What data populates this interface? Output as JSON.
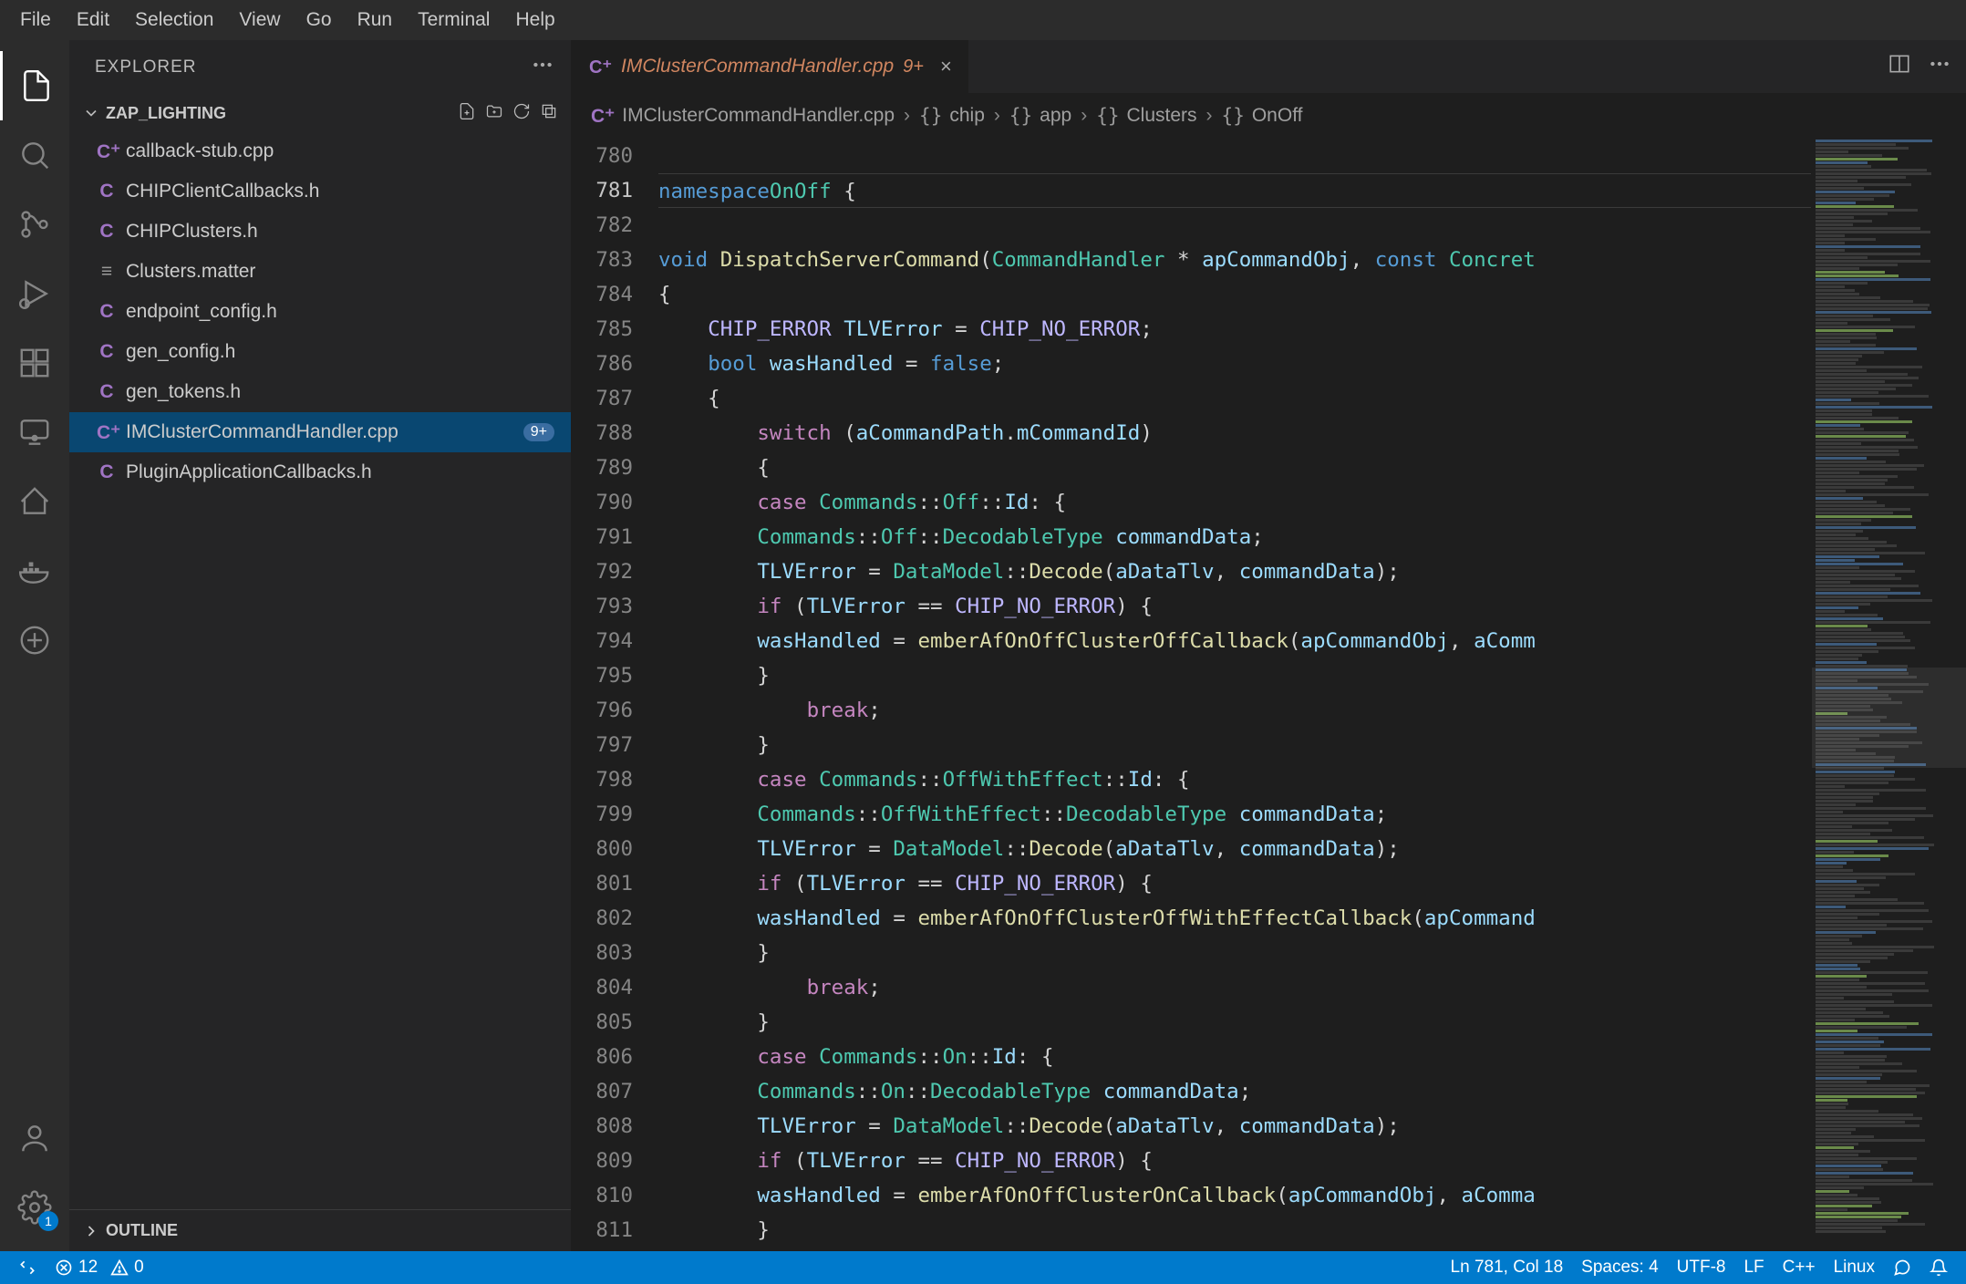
{
  "menubar": [
    "File",
    "Edit",
    "Selection",
    "View",
    "Go",
    "Run",
    "Terminal",
    "Help"
  ],
  "sidebar": {
    "title": "EXPLORER",
    "section": "ZAP_LIGHTING",
    "outline": "OUTLINE",
    "files": [
      {
        "name": "callback-stub.cpp",
        "icon": "C⁺",
        "iconClass": "cpp"
      },
      {
        "name": "CHIPClientCallbacks.h",
        "icon": "C",
        "iconClass": "c"
      },
      {
        "name": "CHIPClusters.h",
        "icon": "C",
        "iconClass": "c"
      },
      {
        "name": "Clusters.matter",
        "icon": "≡",
        "iconClass": "matter"
      },
      {
        "name": "endpoint_config.h",
        "icon": "C",
        "iconClass": "c"
      },
      {
        "name": "gen_config.h",
        "icon": "C",
        "iconClass": "c"
      },
      {
        "name": "gen_tokens.h",
        "icon": "C",
        "iconClass": "c"
      },
      {
        "name": "IMClusterCommandHandler.cpp",
        "icon": "C⁺",
        "iconClass": "cpp",
        "selected": true,
        "badge": "9+"
      },
      {
        "name": "PluginApplicationCallbacks.h",
        "icon": "C",
        "iconClass": "c"
      }
    ]
  },
  "activityBadge": "1",
  "tab": {
    "name": "IMClusterCommandHandler.cpp",
    "badge": "9+"
  },
  "breadcrumb": [
    {
      "icon": "C⁺",
      "label": "IMClusterCommandHandler.cpp"
    },
    {
      "icon": "{}",
      "label": "chip"
    },
    {
      "icon": "{}",
      "label": "app"
    },
    {
      "icon": "{}",
      "label": "Clusters"
    },
    {
      "icon": "{}",
      "label": "OnOff"
    }
  ],
  "code": {
    "startLine": 780,
    "currentLine": 781,
    "lines": [
      {
        "n": 780,
        "tokens": []
      },
      {
        "n": 781,
        "tokens": [
          [
            "kw",
            "namespace"
          ],
          [
            "",
            ""
          ],
          [
            "type",
            "OnOff"
          ],
          [
            "",
            " {"
          ]
        ]
      },
      {
        "n": 782,
        "tokens": []
      },
      {
        "n": 783,
        "tokens": [
          [
            "kw",
            "void"
          ],
          [
            "",
            " "
          ],
          [
            "fn",
            "DispatchServerCommand"
          ],
          [
            "",
            "("
          ],
          [
            "type",
            "CommandHandler"
          ],
          [
            "",
            " * "
          ],
          [
            "ident",
            "apCommandObj"
          ],
          [
            "",
            ", "
          ],
          [
            "kw",
            "const"
          ],
          [
            "",
            " "
          ],
          [
            "type",
            "Concret"
          ]
        ]
      },
      {
        "n": 784,
        "tokens": [
          [
            "",
            "{"
          ]
        ]
      },
      {
        "n": 785,
        "tokens": [
          [
            "",
            "    "
          ],
          [
            "macro",
            "CHIP_ERROR"
          ],
          [
            "",
            " "
          ],
          [
            "ident",
            "TLVError"
          ],
          [
            "",
            " = "
          ],
          [
            "macro",
            "CHIP_NO_ERROR"
          ],
          [
            "",
            ";"
          ]
        ]
      },
      {
        "n": 786,
        "tokens": [
          [
            "",
            "    "
          ],
          [
            "kw",
            "bool"
          ],
          [
            "",
            " "
          ],
          [
            "ident",
            "wasHandled"
          ],
          [
            "",
            " = "
          ],
          [
            "kw",
            "false"
          ],
          [
            "",
            ";"
          ]
        ]
      },
      {
        "n": 787,
        "tokens": [
          [
            "",
            "    {"
          ]
        ]
      },
      {
        "n": 788,
        "tokens": [
          [
            "",
            "        "
          ],
          [
            "ctrl",
            "switch"
          ],
          [
            "",
            " ("
          ],
          [
            "ident",
            "aCommandPath"
          ],
          [
            "",
            "."
          ],
          [
            "ident",
            "mCommandId"
          ],
          [
            "",
            ")"
          ]
        ]
      },
      {
        "n": 789,
        "tokens": [
          [
            "",
            "        {"
          ]
        ]
      },
      {
        "n": 790,
        "tokens": [
          [
            "",
            "        "
          ],
          [
            "ctrl",
            "case"
          ],
          [
            "",
            " "
          ],
          [
            "type",
            "Commands"
          ],
          [
            "",
            "::"
          ],
          [
            "type",
            "Off"
          ],
          [
            "",
            "::"
          ],
          [
            "ident",
            "Id"
          ],
          [
            "",
            ": {"
          ]
        ]
      },
      {
        "n": 791,
        "tokens": [
          [
            "",
            "        "
          ],
          [
            "type",
            "Commands"
          ],
          [
            "",
            "::"
          ],
          [
            "type",
            "Off"
          ],
          [
            "",
            "::"
          ],
          [
            "type",
            "DecodableType"
          ],
          [
            "",
            " "
          ],
          [
            "ident",
            "commandData"
          ],
          [
            "",
            ";"
          ]
        ]
      },
      {
        "n": 792,
        "tokens": [
          [
            "",
            "        "
          ],
          [
            "ident",
            "TLVError"
          ],
          [
            "",
            " = "
          ],
          [
            "type",
            "DataModel"
          ],
          [
            "",
            "::"
          ],
          [
            "fn",
            "Decode"
          ],
          [
            "",
            "("
          ],
          [
            "ident",
            "aDataTlv"
          ],
          [
            "",
            ", "
          ],
          [
            "ident",
            "commandData"
          ],
          [
            "",
            ");"
          ]
        ]
      },
      {
        "n": 793,
        "tokens": [
          [
            "",
            "        "
          ],
          [
            "ctrl",
            "if"
          ],
          [
            "",
            " ("
          ],
          [
            "ident",
            "TLVError"
          ],
          [
            "",
            " == "
          ],
          [
            "macro",
            "CHIP_NO_ERROR"
          ],
          [
            "",
            ") {"
          ]
        ]
      },
      {
        "n": 794,
        "tokens": [
          [
            "",
            "        "
          ],
          [
            "ident",
            "wasHandled"
          ],
          [
            "",
            " = "
          ],
          [
            "fn",
            "emberAfOnOffClusterOffCallback"
          ],
          [
            "",
            "("
          ],
          [
            "ident",
            "apCommandObj"
          ],
          [
            "",
            ", "
          ],
          [
            "ident",
            "aComm"
          ]
        ]
      },
      {
        "n": 795,
        "tokens": [
          [
            "",
            "        }"
          ]
        ]
      },
      {
        "n": 796,
        "tokens": [
          [
            "",
            "            "
          ],
          [
            "ctrl",
            "break"
          ],
          [
            "",
            ";"
          ]
        ]
      },
      {
        "n": 797,
        "tokens": [
          [
            "",
            "        }"
          ]
        ]
      },
      {
        "n": 798,
        "tokens": [
          [
            "",
            "        "
          ],
          [
            "ctrl",
            "case"
          ],
          [
            "",
            " "
          ],
          [
            "type",
            "Commands"
          ],
          [
            "",
            "::"
          ],
          [
            "type",
            "OffWithEffect"
          ],
          [
            "",
            "::"
          ],
          [
            "ident",
            "Id"
          ],
          [
            "",
            ": {"
          ]
        ]
      },
      {
        "n": 799,
        "tokens": [
          [
            "",
            "        "
          ],
          [
            "type",
            "Commands"
          ],
          [
            "",
            "::"
          ],
          [
            "type",
            "OffWithEffect"
          ],
          [
            "",
            "::"
          ],
          [
            "type",
            "DecodableType"
          ],
          [
            "",
            " "
          ],
          [
            "ident",
            "commandData"
          ],
          [
            "",
            ";"
          ]
        ]
      },
      {
        "n": 800,
        "tokens": [
          [
            "",
            "        "
          ],
          [
            "ident",
            "TLVError"
          ],
          [
            "",
            " = "
          ],
          [
            "type",
            "DataModel"
          ],
          [
            "",
            "::"
          ],
          [
            "fn",
            "Decode"
          ],
          [
            "",
            "("
          ],
          [
            "ident",
            "aDataTlv"
          ],
          [
            "",
            ", "
          ],
          [
            "ident",
            "commandData"
          ],
          [
            "",
            ");"
          ]
        ]
      },
      {
        "n": 801,
        "tokens": [
          [
            "",
            "        "
          ],
          [
            "ctrl",
            "if"
          ],
          [
            "",
            " ("
          ],
          [
            "ident",
            "TLVError"
          ],
          [
            "",
            " == "
          ],
          [
            "macro",
            "CHIP_NO_ERROR"
          ],
          [
            "",
            ") {"
          ]
        ]
      },
      {
        "n": 802,
        "tokens": [
          [
            "",
            "        "
          ],
          [
            "ident",
            "wasHandled"
          ],
          [
            "",
            " = "
          ],
          [
            "fn",
            "emberAfOnOffClusterOffWithEffectCallback"
          ],
          [
            "",
            "("
          ],
          [
            "ident",
            "apCommand"
          ]
        ]
      },
      {
        "n": 803,
        "tokens": [
          [
            "",
            "        }"
          ]
        ]
      },
      {
        "n": 804,
        "tokens": [
          [
            "",
            "            "
          ],
          [
            "ctrl",
            "break"
          ],
          [
            "",
            ";"
          ]
        ]
      },
      {
        "n": 805,
        "tokens": [
          [
            "",
            "        }"
          ]
        ]
      },
      {
        "n": 806,
        "tokens": [
          [
            "",
            "        "
          ],
          [
            "ctrl",
            "case"
          ],
          [
            "",
            " "
          ],
          [
            "type",
            "Commands"
          ],
          [
            "",
            "::"
          ],
          [
            "type",
            "On"
          ],
          [
            "",
            "::"
          ],
          [
            "ident",
            "Id"
          ],
          [
            "",
            ": {"
          ]
        ]
      },
      {
        "n": 807,
        "tokens": [
          [
            "",
            "        "
          ],
          [
            "type",
            "Commands"
          ],
          [
            "",
            "::"
          ],
          [
            "type",
            "On"
          ],
          [
            "",
            "::"
          ],
          [
            "type",
            "DecodableType"
          ],
          [
            "",
            " "
          ],
          [
            "ident",
            "commandData"
          ],
          [
            "",
            ";"
          ]
        ]
      },
      {
        "n": 808,
        "tokens": [
          [
            "",
            "        "
          ],
          [
            "ident",
            "TLVError"
          ],
          [
            "",
            " = "
          ],
          [
            "type",
            "DataModel"
          ],
          [
            "",
            "::"
          ],
          [
            "fn",
            "Decode"
          ],
          [
            "",
            "("
          ],
          [
            "ident",
            "aDataTlv"
          ],
          [
            "",
            ", "
          ],
          [
            "ident",
            "commandData"
          ],
          [
            "",
            ");"
          ]
        ]
      },
      {
        "n": 809,
        "tokens": [
          [
            "",
            "        "
          ],
          [
            "ctrl",
            "if"
          ],
          [
            "",
            " ("
          ],
          [
            "ident",
            "TLVError"
          ],
          [
            "",
            " == "
          ],
          [
            "macro",
            "CHIP_NO_ERROR"
          ],
          [
            "",
            ") {"
          ]
        ]
      },
      {
        "n": 810,
        "tokens": [
          [
            "",
            "        "
          ],
          [
            "ident",
            "wasHandled"
          ],
          [
            "",
            " = "
          ],
          [
            "fn",
            "emberAfOnOffClusterOnCallback"
          ],
          [
            "",
            "("
          ],
          [
            "ident",
            "apCommandObj"
          ],
          [
            "",
            ", "
          ],
          [
            "ident",
            "aComma"
          ]
        ]
      },
      {
        "n": 811,
        "tokens": [
          [
            "",
            "        }"
          ]
        ]
      }
    ]
  },
  "statusbar": {
    "errors": "12",
    "warnings": "0",
    "cursor": "Ln 781, Col 18",
    "spaces": "Spaces: 4",
    "encoding": "UTF-8",
    "eol": "LF",
    "lang": "C++",
    "os": "Linux"
  }
}
